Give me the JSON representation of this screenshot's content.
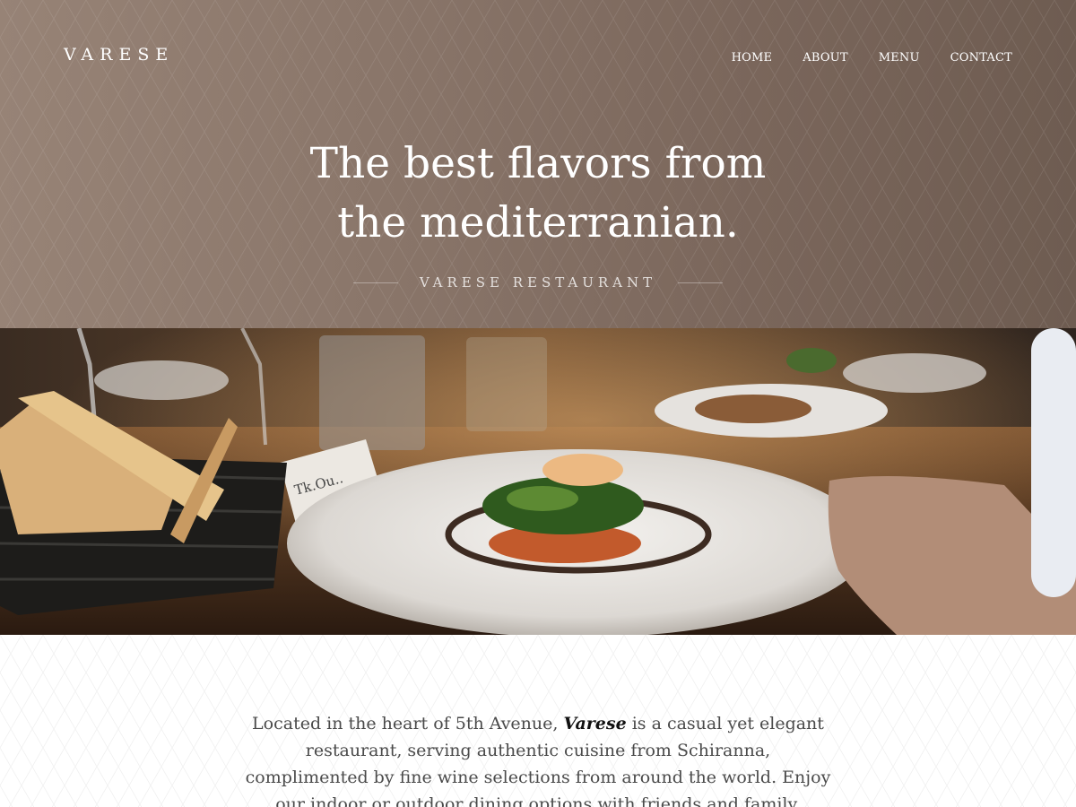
{
  "brand": "VARESE",
  "nav": {
    "items": [
      {
        "label": "HOME"
      },
      {
        "label": "ABOUT"
      },
      {
        "label": "MENU"
      },
      {
        "label": "CONTACT"
      }
    ]
  },
  "hero": {
    "title_line1": "The best flavors from",
    "title_line2": "the mediterranian.",
    "subtitle": "VARESE RESTAURANT"
  },
  "about": {
    "text_before": "Located in the heart of 5th Avenue, ",
    "highlight": "Varese",
    "text_after": " is a casual yet elegant restaurant, serving authentic cuisine from Schiranna, complimented by fine wine selections from around the world. Enjoy our indoor or outdoor dining options with friends and family."
  },
  "photo": {
    "place_card_text": "Tk.Ou.."
  },
  "colors": {
    "hero_left": "#978376",
    "hero_right": "#6e5c51",
    "text_body": "#4a4a4a",
    "text_heading": "#ffffff"
  },
  "icons": {
    "hero_pattern": "triangle-pattern",
    "about_pattern": "triangle-pattern"
  }
}
